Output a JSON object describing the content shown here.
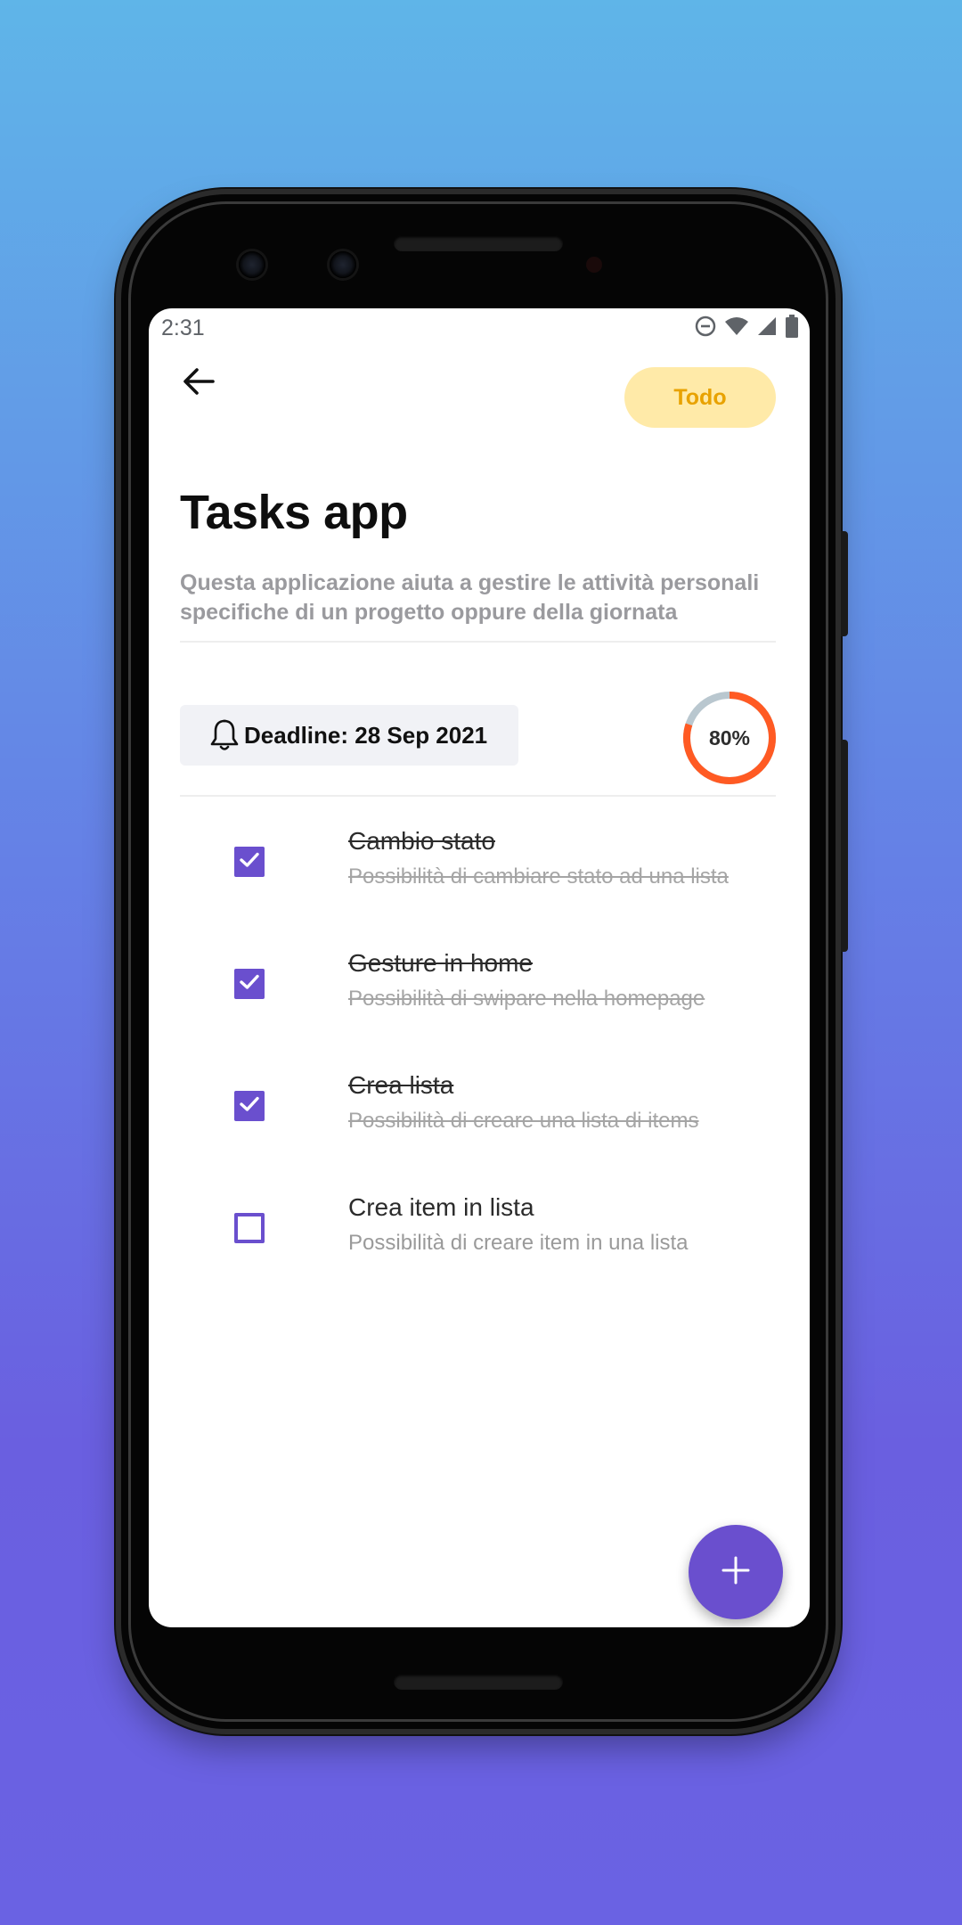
{
  "status_bar": {
    "time": "2:31",
    "icons": [
      "do-not-disturb-icon",
      "wifi-icon",
      "signal-icon",
      "battery-icon"
    ]
  },
  "header": {
    "back_icon": "arrow-left-icon",
    "status_chip_label": "Todo"
  },
  "project": {
    "title": "Tasks app",
    "description": "Questa applicazione aiuta a gestire le attività personali specifiche di un progetto oppure della giornata",
    "deadline_icon": "bell-icon",
    "deadline": "Deadline: 28 Sep 2021",
    "progress_percent": 80,
    "progress_label": "80%"
  },
  "tasks": [
    {
      "title": "Cambio stato",
      "subtitle": "Possibilità di cambiare stato ad una lista",
      "done": true
    },
    {
      "title": "Gesture in home",
      "subtitle": "Possibilità di swipare nella homepage",
      "done": true
    },
    {
      "title": "Crea lista",
      "subtitle": "Possibilità di creare una lista di items",
      "done": true
    },
    {
      "title": "Crea item in lista",
      "subtitle": "Possibilità di creare item in una lista",
      "done": false
    }
  ],
  "fab": {
    "icon": "plus-icon"
  },
  "colors": {
    "accent": "#6a4fce",
    "chip_bg": "#ffeaa8",
    "chip_text": "#e8a200",
    "progress": "#ff5a23",
    "progress_track": "#b9c7cf"
  }
}
